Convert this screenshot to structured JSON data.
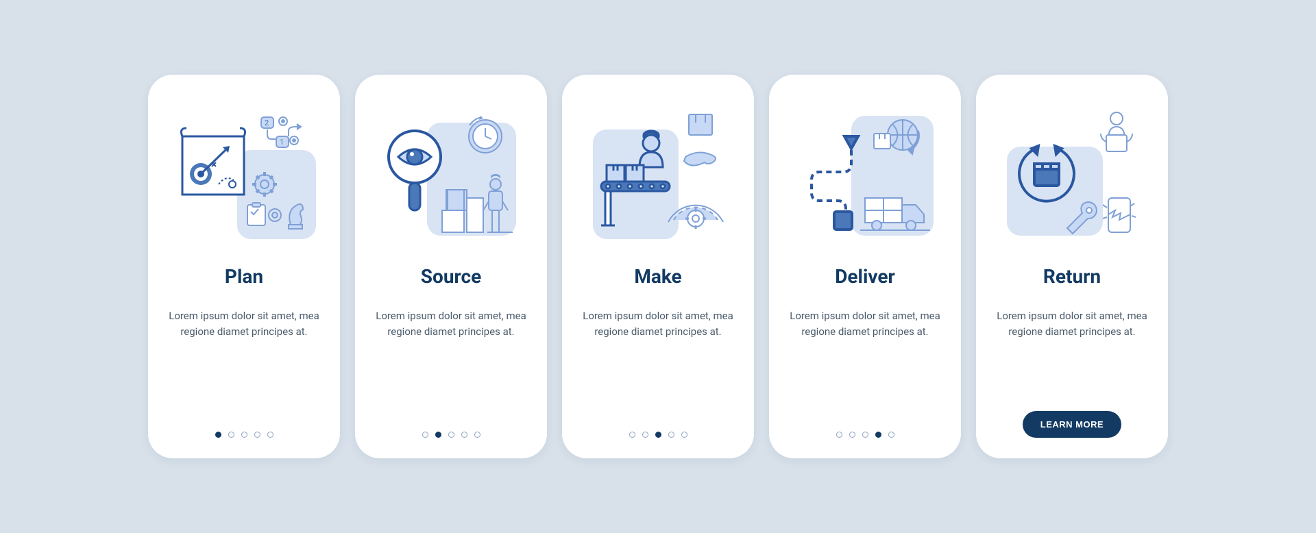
{
  "cards": [
    {
      "title": "Plan",
      "desc": "Lorem ipsum dolor sit amet, mea regione diamet principes at.",
      "activeDot": 0
    },
    {
      "title": "Source",
      "desc": "Lorem ipsum dolor sit amet, mea regione diamet principes at.",
      "activeDot": 1
    },
    {
      "title": "Make",
      "desc": "Lorem ipsum dolor sit amet, mea regione diamet principes at.",
      "activeDot": 2
    },
    {
      "title": "Deliver",
      "desc": "Lorem ipsum dolor sit amet, mea regione diamet principes at.",
      "activeDot": 3
    },
    {
      "title": "Return",
      "desc": "Lorem ipsum dolor sit amet, mea regione diamet principes at.",
      "activeDot": 4,
      "cta": "LEARN MORE"
    }
  ],
  "dotCount": 5,
  "colors": {
    "stroke": "#4a78b8",
    "fill": "#c8d9f5",
    "dark": "#2a57a0",
    "bg": "#d8e3f4"
  }
}
